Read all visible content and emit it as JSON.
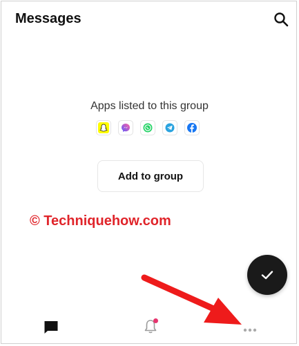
{
  "header": {
    "title": "Messages",
    "search_icon": "search-icon"
  },
  "group": {
    "label": "Apps listed to this group",
    "apps": [
      "snapchat",
      "messenger",
      "whatsapp",
      "telegram",
      "facebook"
    ],
    "add_button": "Add to group"
  },
  "watermark": "© Techniquehow.com",
  "fab": {
    "icon": "check-icon"
  },
  "bottom_nav": {
    "items": [
      "chat-icon",
      "bell-icon",
      "more-icon"
    ],
    "notification_dot": true
  },
  "colors": {
    "accent": "#e0242a",
    "fab": "#1a1a1a",
    "notification": "#e6356f"
  }
}
